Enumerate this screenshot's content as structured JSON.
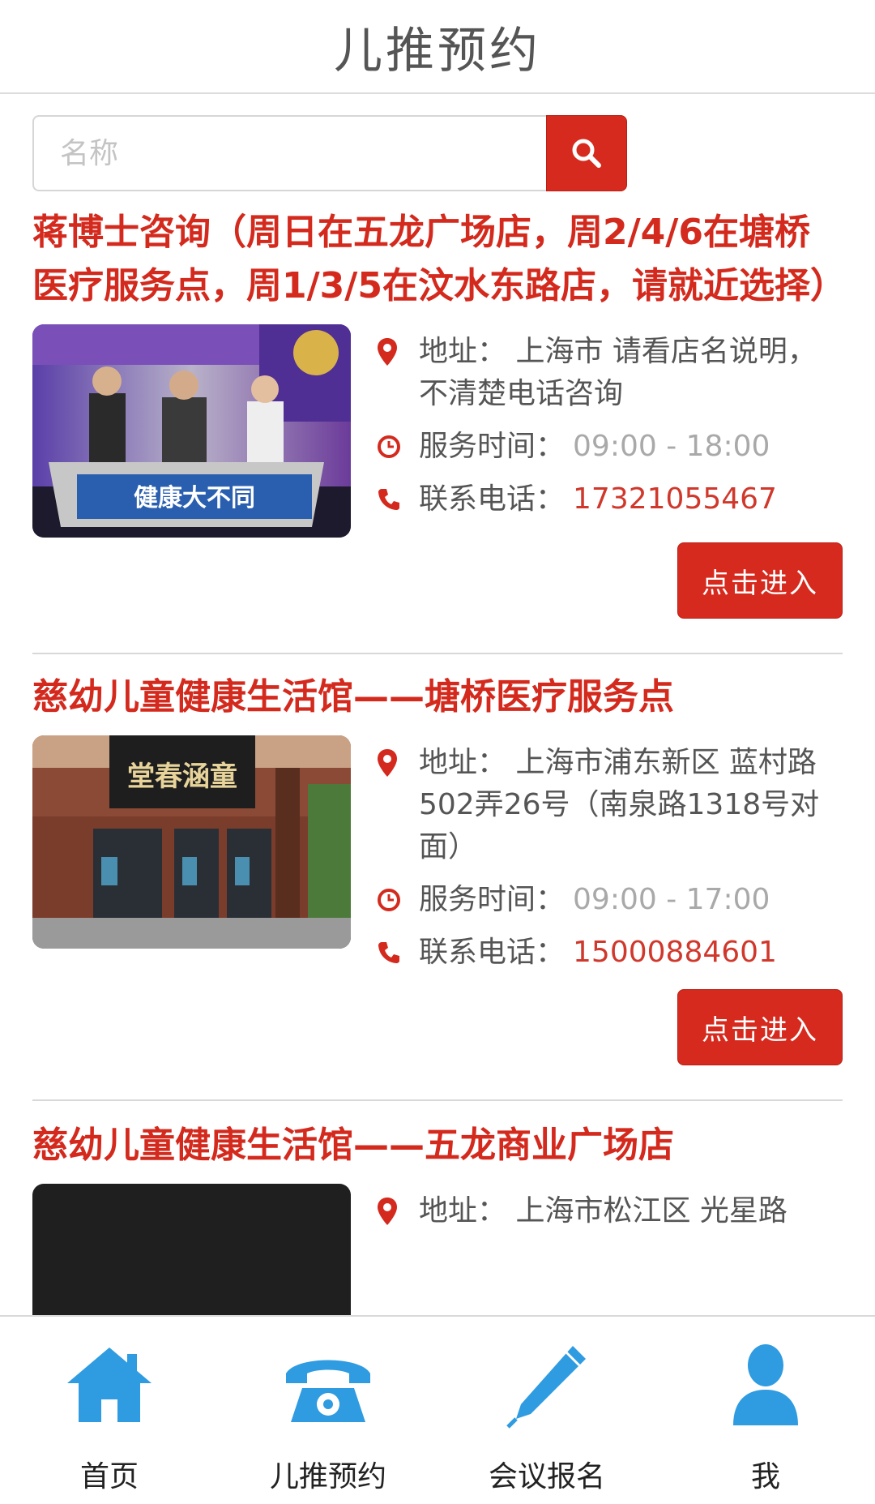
{
  "header": {
    "title": "儿推预约"
  },
  "search": {
    "placeholder": "名称"
  },
  "colors": {
    "accent": "#d72a1e",
    "title_red": "#d42a1e",
    "phone_red": "#d0382c",
    "tab_icon_blue": "#2f9be0"
  },
  "labels": {
    "address": "地址：",
    "hours": "服务时间：",
    "phone": "联系电话：",
    "enter": "点击进入"
  },
  "stores": [
    {
      "name": "蒋博士咨询（周日在五龙广场店，周2/4/6在塘桥医疗服务点，周1/3/5在汶水东路店，请就近选择）",
      "photo_caption": "健康大不同",
      "address": "上海市 请看店名说明，不清楚电话咨询",
      "hours": "09:00 - 18:00",
      "phone": "17321055467"
    },
    {
      "name": "慈幼儿童健康生活馆——塘桥医疗服务点",
      "photo_caption": "堂春涵童",
      "address": "上海市浦东新区 蓝村路502弄26号（南泉路1318号对面）",
      "hours": "09:00 - 17:00",
      "phone": "15000884601"
    },
    {
      "name": "慈幼儿童健康生活馆——五龙商业广场店",
      "address": "上海市松江区 光星路"
    }
  ],
  "tabbar": [
    {
      "label": "首页",
      "icon": "home-icon"
    },
    {
      "label": "儿推预约",
      "icon": "telephone-icon"
    },
    {
      "label": "会议报名",
      "icon": "pen-icon"
    },
    {
      "label": "我",
      "icon": "user-icon"
    }
  ]
}
